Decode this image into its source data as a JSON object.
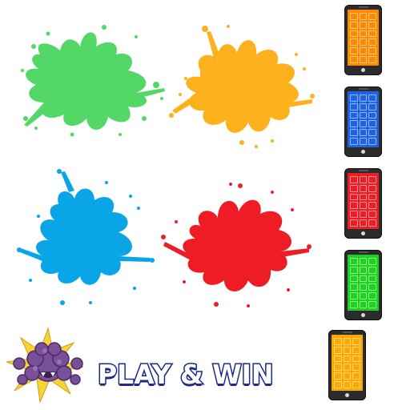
{
  "colors": {
    "green": "#53d767",
    "orange": "#fcb11d",
    "blue": "#0aa5e7",
    "red": "#ee1c25",
    "phone_orange": "#ff8a00",
    "phone_blue": "#1e62e6",
    "phone_red": "#ee1c25",
    "phone_green": "#1ed31e",
    "phone_amber": "#ffa800",
    "title_stroke": "#1b2a8c",
    "monster_purple": "#7a4f9a"
  },
  "splats": [
    {
      "name": "green-paint-splat",
      "color": "green"
    },
    {
      "name": "orange-paint-splat",
      "color": "orange"
    },
    {
      "name": "blue-paint-splat",
      "color": "blue"
    },
    {
      "name": "red-paint-splat",
      "color": "red"
    }
  ],
  "phones": [
    {
      "name": "phone-orange",
      "color": "phone_orange"
    },
    {
      "name": "phone-blue",
      "color": "phone_blue"
    },
    {
      "name": "phone-red",
      "color": "phone_red"
    },
    {
      "name": "phone-green",
      "color": "phone_green"
    },
    {
      "name": "phone-amber",
      "color": "phone_amber"
    }
  ],
  "cta": {
    "label": "PLAY & WIN"
  },
  "icons": {
    "mascot": "purple-monster-icon"
  }
}
